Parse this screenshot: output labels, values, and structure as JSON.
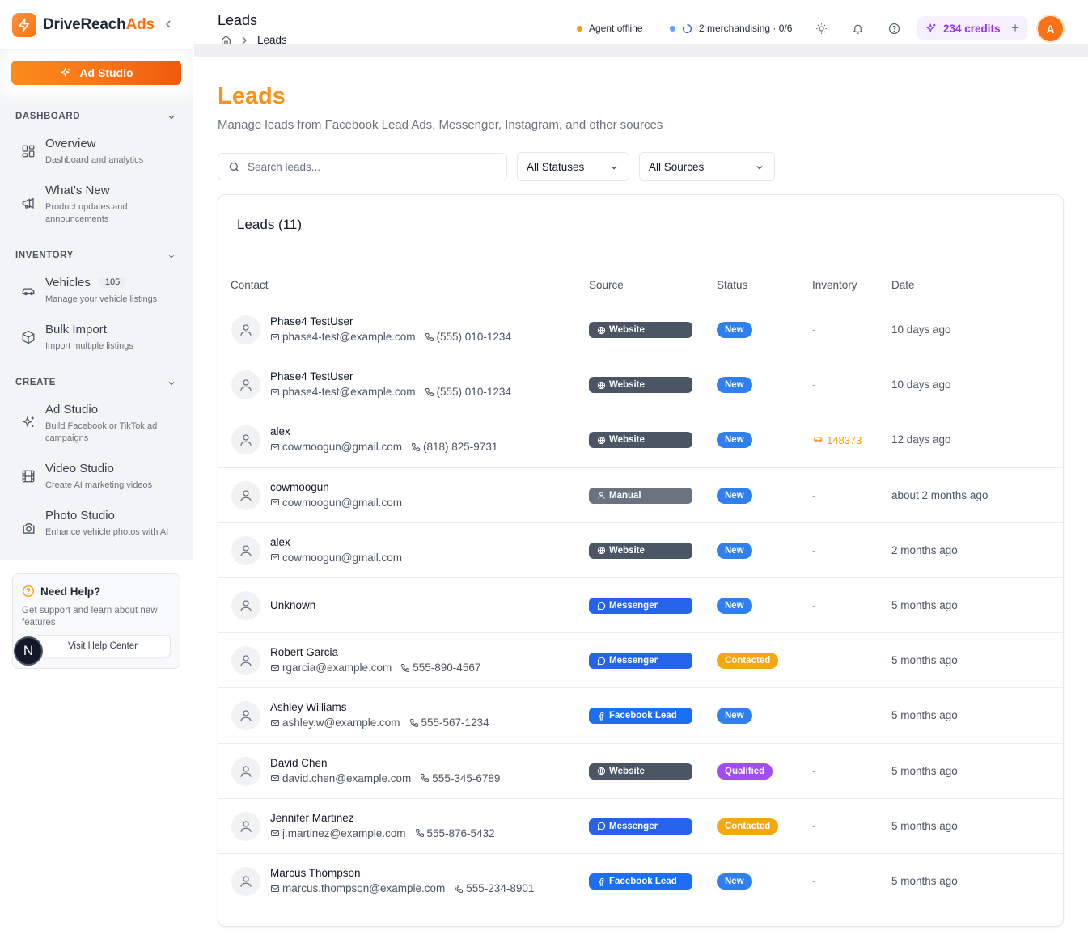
{
  "brand": {
    "name_main": "DriveReach",
    "name_accent": "Ads"
  },
  "sidebar": {
    "ad_studio_button": "Ad Studio",
    "sections": [
      {
        "label": "DASHBOARD"
      },
      {
        "label": "INVENTORY"
      },
      {
        "label": "CREATE"
      }
    ],
    "items": [
      {
        "title": "Overview",
        "subtitle": "Dashboard and analytics",
        "icon": "grid-icon"
      },
      {
        "title": "What's New",
        "subtitle": "Product updates and announcements",
        "icon": "megaphone-icon"
      },
      {
        "title": "Vehicles",
        "subtitle": "Manage your vehicle listings",
        "badge": "105",
        "icon": "car-icon"
      },
      {
        "title": "Bulk Import",
        "subtitle": "Import multiple listings",
        "icon": "package-icon"
      },
      {
        "title": "Ad Studio",
        "subtitle": "Build Facebook or TikTok ad campaigns",
        "icon": "sparkles-icon"
      },
      {
        "title": "Video Studio",
        "subtitle": "Create AI marketing videos",
        "icon": "film-icon"
      },
      {
        "title": "Photo Studio",
        "subtitle": "Enhance vehicle photos with AI",
        "icon": "camera-icon"
      }
    ],
    "help": {
      "title": "Need Help?",
      "description": "Get support and learn about new features",
      "button": "Visit Help Center"
    },
    "user_badge": "N"
  },
  "header": {
    "title": "Leads",
    "breadcrumb_current": "Leads",
    "agent_status": "Agent offline",
    "merch_status": "2 merchandising · 0/6",
    "credits": "234 credits",
    "avatar_letter": "A"
  },
  "main": {
    "title": "Leads",
    "subtitle": "Manage leads from Facebook Lead Ads, Messenger, Instagram, and other sources",
    "search_placeholder": "Search leads...",
    "status_filter": "All Statuses",
    "source_filter": "All Sources",
    "card_title": "Leads (11)",
    "columns": [
      "Contact",
      "Source",
      "Status",
      "Inventory",
      "Date"
    ]
  },
  "leads": [
    {
      "name": "Phase4 TestUser",
      "email": "phase4-test@example.com",
      "phone": "(555) 010-1234",
      "source": "Website",
      "status": "New",
      "inventory": "-",
      "date": "10 days ago"
    },
    {
      "name": "Phase4 TestUser",
      "email": "phase4-test@example.com",
      "phone": "(555) 010-1234",
      "source": "Website",
      "status": "New",
      "inventory": "-",
      "date": "10 days ago"
    },
    {
      "name": "alex",
      "email": "cowmoogun@gmail.com",
      "phone": "(818) 825-9731",
      "source": "Website",
      "status": "New",
      "inventory": "148373",
      "date": "12 days ago"
    },
    {
      "name": "cowmoogun",
      "email": "cowmoogun@gmail.com",
      "phone": "",
      "source": "Manual",
      "status": "New",
      "inventory": "-",
      "date": "about 2 months ago"
    },
    {
      "name": "alex",
      "email": "cowmoogun@gmail.com",
      "phone": "",
      "source": "Website",
      "status": "New",
      "inventory": "-",
      "date": "2 months ago"
    },
    {
      "name": "Unknown",
      "email": "",
      "phone": "",
      "source": "Messenger",
      "status": "New",
      "inventory": "-",
      "date": "5 months ago"
    },
    {
      "name": "Robert Garcia",
      "email": "rgarcia@example.com",
      "phone": "555-890-4567",
      "source": "Messenger",
      "status": "Contacted",
      "inventory": "-",
      "date": "5 months ago"
    },
    {
      "name": "Ashley Williams",
      "email": "ashley.w@example.com",
      "phone": "555-567-1234",
      "source": "Facebook Lead",
      "status": "New",
      "inventory": "-",
      "date": "5 months ago"
    },
    {
      "name": "David Chen",
      "email": "david.chen@example.com",
      "phone": "555-345-6789",
      "source": "Website",
      "status": "Qualified",
      "inventory": "-",
      "date": "5 months ago"
    },
    {
      "name": "Jennifer Martinez",
      "email": "j.martinez@example.com",
      "phone": "555-876-5432",
      "source": "Messenger",
      "status": "Contacted",
      "inventory": "-",
      "date": "5 months ago"
    },
    {
      "name": "Marcus Thompson",
      "email": "marcus.thompson@example.com",
      "phone": "555-234-8901",
      "source": "Facebook Lead",
      "status": "New",
      "inventory": "-",
      "date": "5 months ago"
    }
  ],
  "colors": {
    "accent": "#f97316",
    "source_website": "#4b5563",
    "source_manual": "#6b7280",
    "source_messenger": "#2563eb",
    "source_facebook": "#1d6ff2",
    "status_new": "#2f80ed",
    "status_contacted": "#f5a70f",
    "status_qualified": "#a24df0"
  }
}
